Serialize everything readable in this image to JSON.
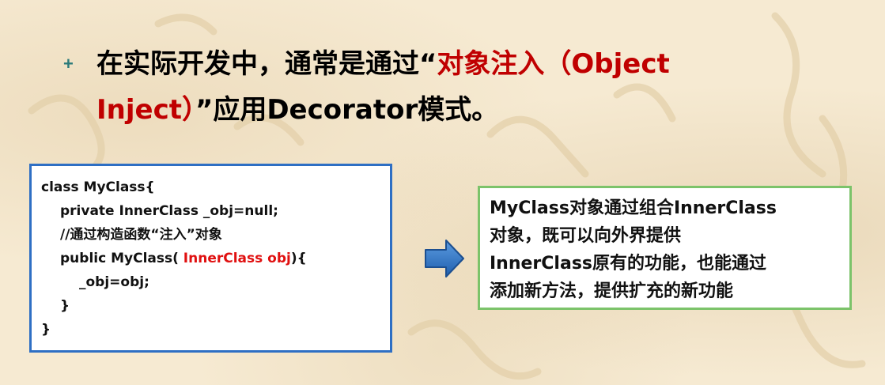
{
  "headline": {
    "bullet": "+",
    "line1_black": "在实际开发中，通常是通过“",
    "line1_red": "对象注入（Object",
    "line2_red": "Inject）",
    "line2_black": "”应用Decorator模式。"
  },
  "code": {
    "line1": "class MyClass{",
    "line2": "private InnerClass _obj=null;",
    "line3": "//通过构造函数“注入”对象",
    "line4_start": "public MyClass( ",
    "line4_red": "InnerClass obj",
    "line4_end": "){",
    "line5": "_obj=obj;",
    "line6": "}",
    "line7": "}"
  },
  "note": {
    "lines": [
      "MyClass对象通过组合InnerClass",
      "对象，既可以向外界提供",
      "InnerClass原有的功能，也能通过",
      "添加新方法，提供扩充的新功能"
    ]
  },
  "colors": {
    "accent_red": "#c00000",
    "code_border": "#2e6fc4",
    "note_border": "#7cc36a",
    "arrow_fill": "#2e75c8"
  }
}
